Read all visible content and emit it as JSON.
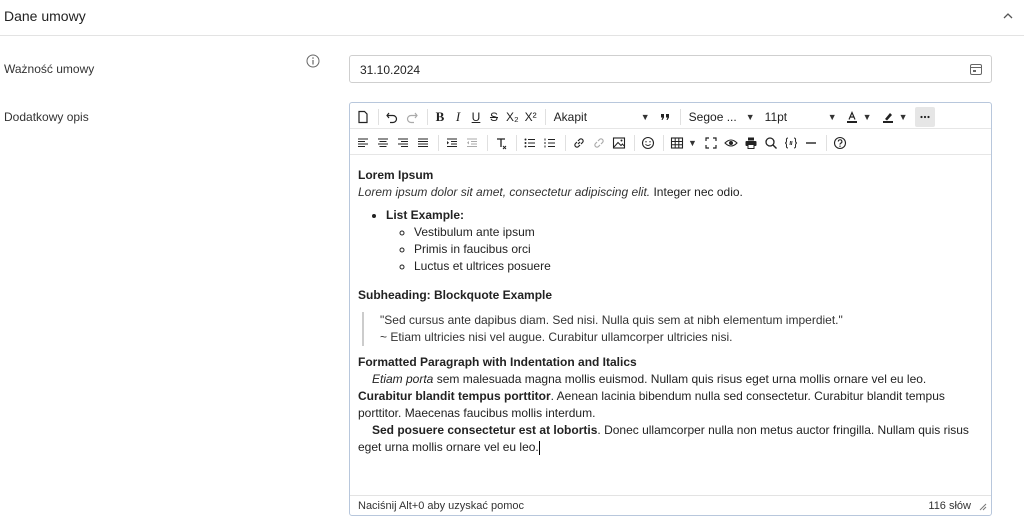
{
  "section": {
    "title": "Dane umowy"
  },
  "fields": {
    "validity_label": "Ważność umowy",
    "validity_value": "31.10.2024",
    "description_label": "Dodatkowy opis"
  },
  "toolbar": {
    "paragraph_select": "Akapit",
    "font_select": "Segoe ...",
    "size_select": "11pt",
    "bold": "B",
    "italic": "I",
    "underline": "U",
    "strike": "S",
    "subscript": "X₂",
    "superscript": "X²",
    "icons_row1": [
      "new-document-icon",
      "undo-icon",
      "redo-icon",
      "bold-icon",
      "italic-icon",
      "underline-icon",
      "strikethrough-icon",
      "subscript-icon",
      "superscript-icon",
      "quote-icon",
      "text-color-icon",
      "highlight-icon",
      "more-icon"
    ],
    "icons_row2": [
      "align-left-icon",
      "align-center-icon",
      "align-right-icon",
      "justify-icon",
      "indent-icon",
      "outdent-icon",
      "clear-format-icon",
      "bullet-list-icon",
      "numbered-list-icon",
      "link-icon",
      "unlink-icon",
      "image-icon",
      "emoji-icon",
      "table-icon",
      "fullscreen-icon",
      "preview-icon",
      "print-icon",
      "search-icon",
      "code-icon",
      "horizontal-line-icon",
      "help-icon"
    ]
  },
  "content": {
    "title": "Lorem Ipsum",
    "subtitle_italic": "Lorem ipsum dolor sit amet, consectetur adipiscing elit.",
    "subtitle_rest": " Integer nec odio.",
    "list_heading": "List Example:",
    "list_items": [
      "Vestibulum ante ipsum",
      "Primis in faucibus orci",
      "Luctus et ultrices posuere"
    ],
    "subheading": "Subheading: Blockquote Example",
    "quote_line1": "\"Sed cursus ante dapibus diam. Sed nisi. Nulla quis sem at nibh elementum imperdiet.\"",
    "quote_line2": "~ Etiam ultricies nisi vel augue. Curabitur ullamcorper ultricies nisi.",
    "formatted_heading": "Formatted Paragraph with Indentation and Italics",
    "p1_italic": "Etiam porta",
    "p1_mid": " sem malesuada magna mollis euismod. Nullam quis risus eget urna mollis ornare vel eu leo. ",
    "p1_bold": "Curabitur blandit tempus porttitor",
    "p1_end": ". Aenean lacinia bibendum nulla sed consectetur. Curabitur blandit tempus porttitor. Maecenas faucibus mollis interdum.",
    "p2_bold": "Sed posuere consectetur est at lobortis",
    "p2_end": ". Donec ullamcorper nulla non metus auctor fringilla. Nullam quis risus eget urna mollis ornare vel eu leo."
  },
  "status": {
    "help": "Naciśnij Alt+0 aby uzyskać pomoc",
    "word_count": "116 słów"
  },
  "colors": {
    "editor_border": "#b8c7dc",
    "field_border": "#cfcfcf",
    "divider": "#e3e3e3"
  }
}
